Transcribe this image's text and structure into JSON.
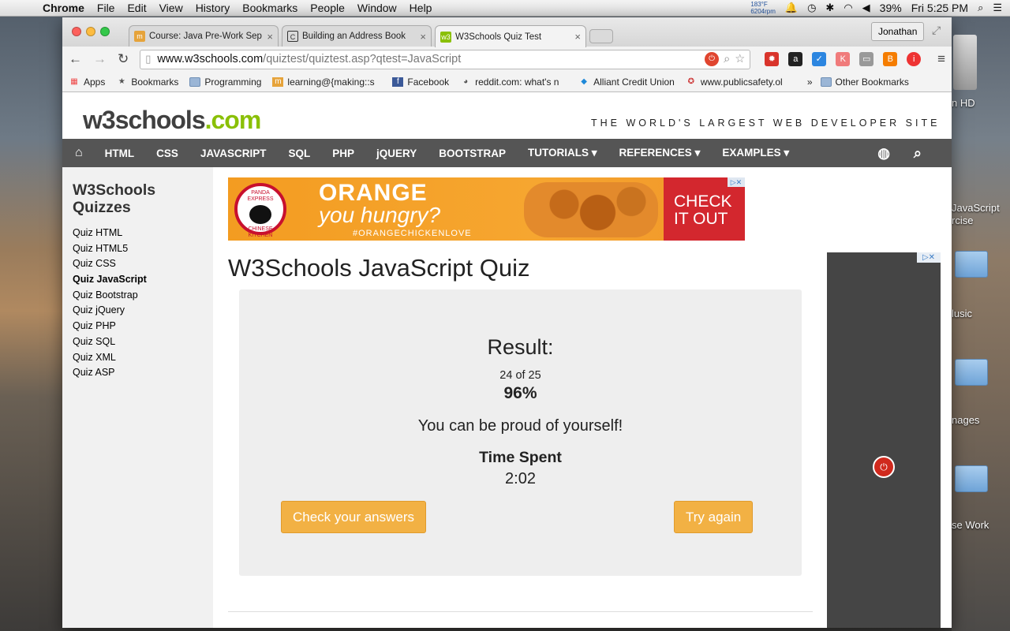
{
  "menubar": {
    "app": "Chrome",
    "items": [
      "File",
      "Edit",
      "View",
      "History",
      "Bookmarks",
      "People",
      "Window",
      "Help"
    ],
    "temp": "183°F",
    "rpm": "6204rpm",
    "battery": "39%",
    "clock": "Fri 5:25 PM"
  },
  "tabs": [
    {
      "title": "Course: Java Pre-Work Sep",
      "icon": "m-logo-icon"
    },
    {
      "title": "Building an Address Book",
      "icon": "codecademy-icon"
    },
    {
      "title": "W3Schools Quiz Test",
      "icon": "w3-icon"
    }
  ],
  "profile": "Jonathan",
  "omnibox": {
    "host": "www.w3schools.com",
    "path": "/quiztest/quiztest.asp?qtest=JavaScript"
  },
  "bookmarks": [
    {
      "label": "Apps",
      "icon": "apps-grid-icon"
    },
    {
      "label": "Bookmarks",
      "icon": "star-icon"
    },
    {
      "label": "Programming",
      "icon": "folder-icon"
    },
    {
      "label": "learning@{making::s",
      "icon": "m-logo-icon"
    },
    {
      "label": "Facebook",
      "icon": "facebook-icon"
    },
    {
      "label": "reddit.com: what's n",
      "icon": "reddit-icon"
    },
    {
      "label": "Alliant Credit Union",
      "icon": "alliant-icon"
    },
    {
      "label": "www.publicsafety.ol",
      "icon": "publicsafety-icon"
    }
  ],
  "bookmarks_more": "»",
  "other_bookmarks": "Other Bookmarks",
  "site": {
    "logo_main": "w3schools",
    "logo_tld": ".com",
    "tagline": "THE WORLD'S LARGEST WEB DEVELOPER SITE",
    "nav": [
      "HTML",
      "CSS",
      "JAVASCRIPT",
      "SQL",
      "PHP",
      "jQUERY",
      "BOOTSTRAP",
      "TUTORIALS ▾",
      "REFERENCES ▾",
      "EXAMPLES ▾"
    ]
  },
  "sidebar": {
    "title_line1": "W3Schools",
    "title_line2": "Quizzes",
    "links": [
      "Quiz HTML",
      "Quiz HTML5",
      "Quiz CSS",
      "Quiz JavaScript",
      "Quiz Bootstrap",
      "Quiz jQuery",
      "Quiz PHP",
      "Quiz SQL",
      "Quiz XML",
      "Quiz ASP"
    ],
    "current_index": 3
  },
  "ad": {
    "brand_line1": "PANDA EXPRESS",
    "brand_line2": "CHINESE KITCHEN",
    "headline1": "ORANGE",
    "headline2": "you hungry?",
    "hashtag": "#ORANGECHICKENLOVE",
    "cta_line1": "CHECK",
    "cta_line2": "IT OUT"
  },
  "quiz": {
    "heading": "W3Schools JavaScript Quiz",
    "result_label": "Result:",
    "score": "24 of 25",
    "percent": "96%",
    "message": "You can be proud of yourself!",
    "time_label": "Time Spent",
    "time_value": "2:02",
    "check_button": "Check your answers",
    "retry_button": "Try again"
  },
  "desktop": {
    "hd_label": "n HD",
    "label_js1": "JavaScript",
    "label_js2": "rcise",
    "label_music": "lusic",
    "label_images": "nages",
    "label_work": "se Work"
  },
  "colors": {
    "accent_green": "#8ac007",
    "nav_bg": "#555555",
    "button": "#f2b144"
  }
}
